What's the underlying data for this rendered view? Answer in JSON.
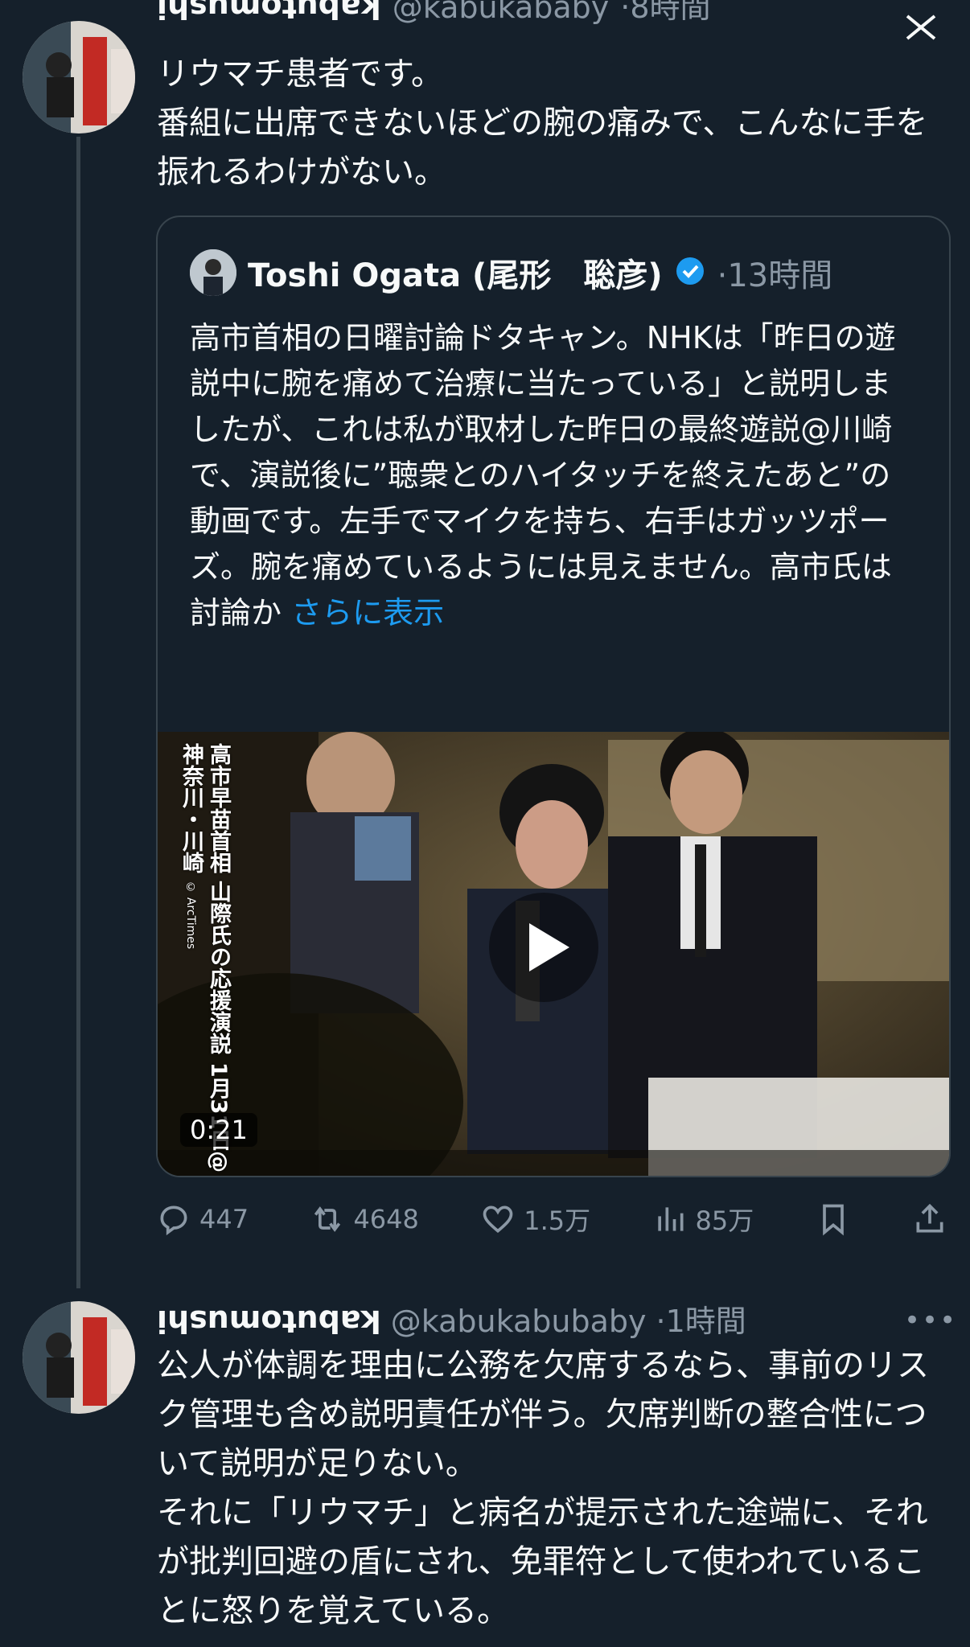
{
  "reply_post": {
    "display_name": "kabutomushi",
    "handle": "@kabukababy",
    "time": "8時間",
    "text": "リウマチ患者です。\n番組に出席できないほどの腕の痛みで、こんなに手を振れるわけがない。",
    "quote": {
      "author": "Toshi Ogata (尾形　聡彦)",
      "time": "13時間",
      "text": "高市首相の日曜討論ドタキャン。NHKは「昨日の遊説中に腕を痛めて治療に当たっている」と説明しましたが、これは私が取材した昨日の最終遊説@川崎で、演説後に”聴衆とのハイタッチを終えたあと”の動画です。左手でマイクを持ち、右手はガッツポーズ。腕を痛めているようには見えません。高市氏は討論か",
      "show_more": "さらに表示",
      "video": {
        "caption_line1": "高市早苗首相 山際氏の応援演説",
        "caption_line2": "1月31日@神奈川・川崎",
        "watermark": "© ArcTimes",
        "duration": "0:21"
      }
    },
    "actions": {
      "replies": "447",
      "reposts": "4648",
      "likes": "1.5万",
      "views": "85万"
    }
  },
  "second_post": {
    "display_name": "kabutomushi",
    "handle": "@kabukabubaby",
    "time": "1時間",
    "text": "公人が体調を理由に公務を欠席するなら、事前のリスク管理も含め説明責任が伴う。欠席判断の整合性について説明が足りない。\nそれに「リウマチ」と病名が提示された途端に、それが批判回避の盾にされ、免罪符として使われていることに怒りを覚えている。"
  },
  "colors": {
    "background": "#15202b",
    "text": "#f7f9f9",
    "secondary": "#8b98a5",
    "link": "#1d9bf0",
    "border": "#38444d"
  }
}
